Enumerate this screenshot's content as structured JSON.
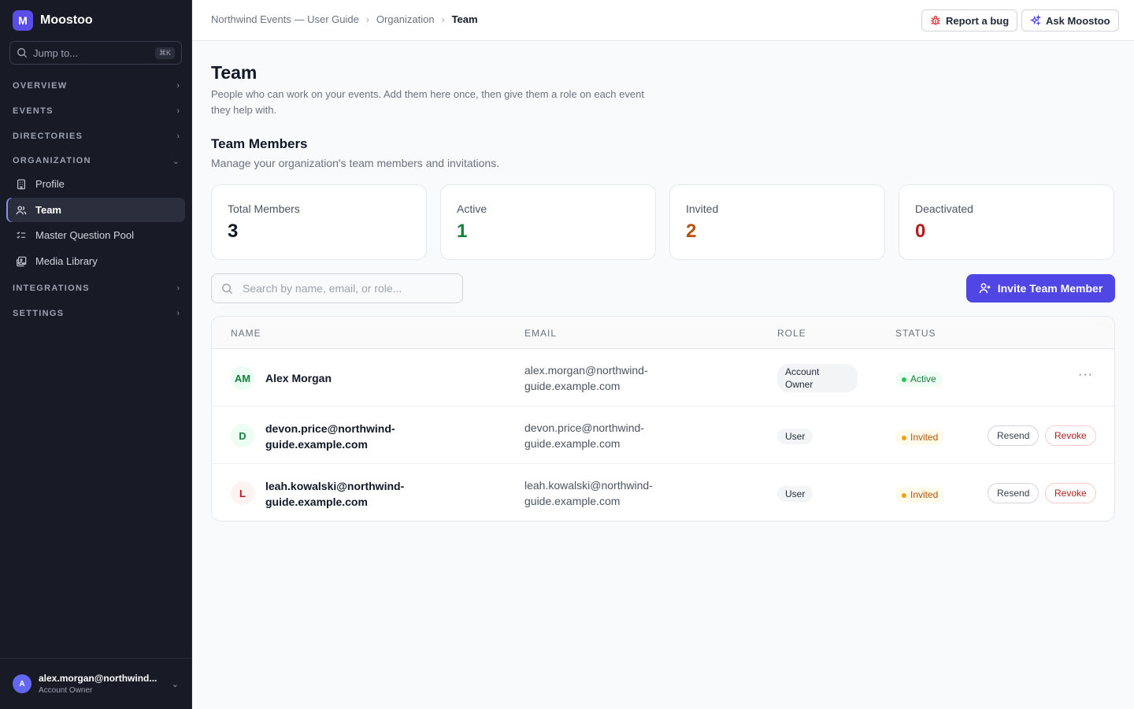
{
  "brand": {
    "initial": "M",
    "name": "Moostoo"
  },
  "jump": {
    "placeholder": "Jump to...",
    "shortcut": "⌘K"
  },
  "sidebar": {
    "sections": [
      {
        "label": "OVERVIEW"
      },
      {
        "label": "EVENTS"
      },
      {
        "label": "DIRECTORIES"
      },
      {
        "label": "ORGANIZATION"
      },
      {
        "label": "INTEGRATIONS"
      },
      {
        "label": "SETTINGS"
      }
    ],
    "items": [
      {
        "label": "Profile",
        "icon": "building-icon"
      },
      {
        "label": "Team",
        "icon": "users-icon",
        "active": true
      },
      {
        "label": "Master Question Pool",
        "icon": "checklist-icon"
      },
      {
        "label": "Media Library",
        "icon": "images-icon"
      }
    ]
  },
  "user": {
    "initial": "A",
    "email": "alex.morgan@northwind...",
    "role": "Account Owner"
  },
  "breadcrumb": {
    "items": [
      "Northwind Events — User Guide",
      "Organization",
      "Team"
    ]
  },
  "topbar": {
    "report_label": "Report a bug",
    "ask_label": "Ask Moostoo"
  },
  "page": {
    "title": "Team",
    "description": "People who can work on your events. Add them here once, then give them a role on each event they help with."
  },
  "section": {
    "title": "Team Members",
    "description": "Manage your organization's team members and invitations."
  },
  "stats": [
    {
      "label": "Total Members",
      "value": "3",
      "color": "#111827"
    },
    {
      "label": "Active",
      "value": "1",
      "color": "#15803d"
    },
    {
      "label": "Invited",
      "value": "2",
      "color": "#b45309"
    },
    {
      "label": "Deactivated",
      "value": "0",
      "color": "#b91c1c"
    }
  ],
  "search": {
    "placeholder": "Search by name, email, or role..."
  },
  "invite": {
    "label": "Invite Team Member"
  },
  "table": {
    "columns": [
      "NAME",
      "EMAIL",
      "ROLE",
      "STATUS"
    ],
    "rows": [
      {
        "initials": "AM",
        "name": "Alex Morgan",
        "email": "alex.morgan@northwind-guide.example.com",
        "role": "Account Owner",
        "status": "Active"
      },
      {
        "initials": "D",
        "name": "devon.price@northwind-guide.example.com",
        "email": "devon.price@northwind-guide.example.com",
        "role": "User",
        "status": "Invited",
        "actions": [
          "Resend",
          "Revoke"
        ]
      },
      {
        "initials": "L",
        "name": "leah.kowalski@northwind-guide.example.com",
        "email": "leah.kowalski@northwind-guide.example.com",
        "role": "User",
        "status": "Invited",
        "actions": [
          "Resend",
          "Revoke"
        ]
      }
    ]
  },
  "colors": {
    "accent": "#4f46e5",
    "active": "#15803d",
    "invited": "#b45309",
    "revoke": "#b91c1c",
    "sidebar": "#181a26"
  }
}
